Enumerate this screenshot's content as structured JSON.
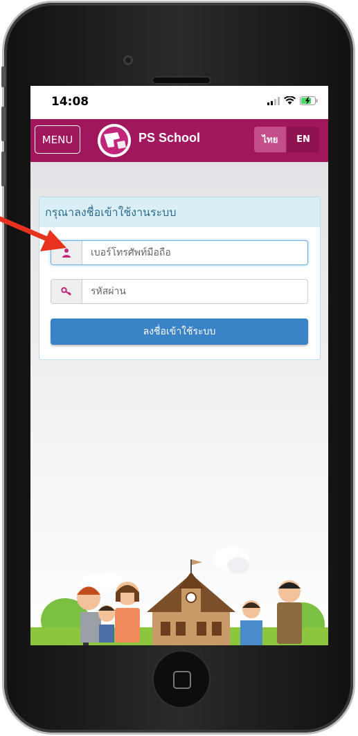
{
  "status_bar": {
    "time": "14:08"
  },
  "navbar": {
    "menu_label": "MENU",
    "brand": "PS School",
    "lang_thai": "ไทย",
    "lang_en": "EN"
  },
  "login": {
    "heading": "กรุณาลงชื่อเข้าใช้งานระบบ",
    "phone_placeholder": "เบอร์โทรศัพท์มือถือ",
    "password_placeholder": "รหัสผ่าน",
    "submit_label": "ลงชื่อเข้าใช้ระบบ"
  },
  "colors": {
    "brand": "#a0175e",
    "accent_blue": "#3a83c6",
    "panel_head": "#daeef6",
    "annotation_arrow": "#e8321e"
  },
  "icons": [
    "signal-icon",
    "wifi-icon",
    "battery-charging-icon",
    "user-icon",
    "key-icon",
    "home-button-icon"
  ]
}
